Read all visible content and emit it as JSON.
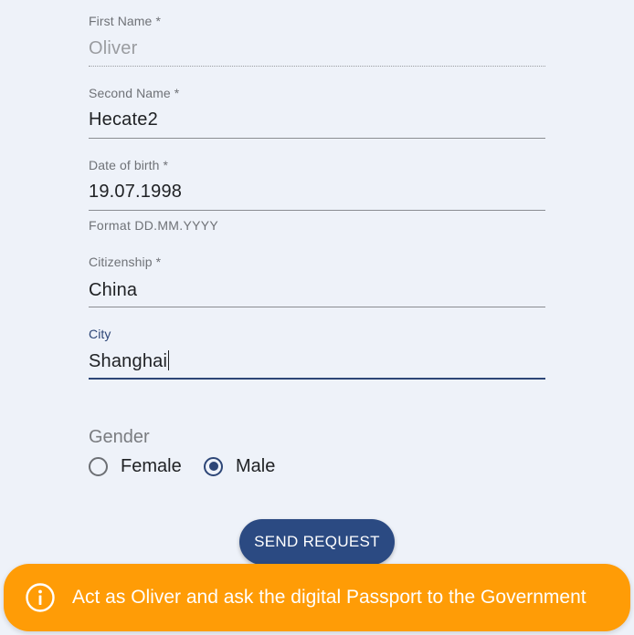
{
  "form": {
    "first_name": {
      "label": "First Name *",
      "value": "Oliver"
    },
    "second_name": {
      "label": "Second Name *",
      "value": "Hecate2"
    },
    "date_of_birth": {
      "label": "Date of birth *",
      "value": "19.07.1998",
      "hint": "Format DD.MM.YYYY"
    },
    "citizenship": {
      "label": "Citizenship *",
      "value": "China"
    },
    "city": {
      "label": "City",
      "value": "Shanghai"
    },
    "gender": {
      "label": "Gender",
      "options": [
        {
          "label": "Female",
          "checked": false
        },
        {
          "label": "Male",
          "checked": true
        }
      ]
    },
    "submit_label": "SEND REQUEST"
  },
  "banner": {
    "icon": "info-icon",
    "text": "Act as Oliver and ask the digital Passport to the Government"
  },
  "colors": {
    "background": "#eef2f9",
    "primary": "#2b4a82",
    "banner": "#ff9c06"
  }
}
